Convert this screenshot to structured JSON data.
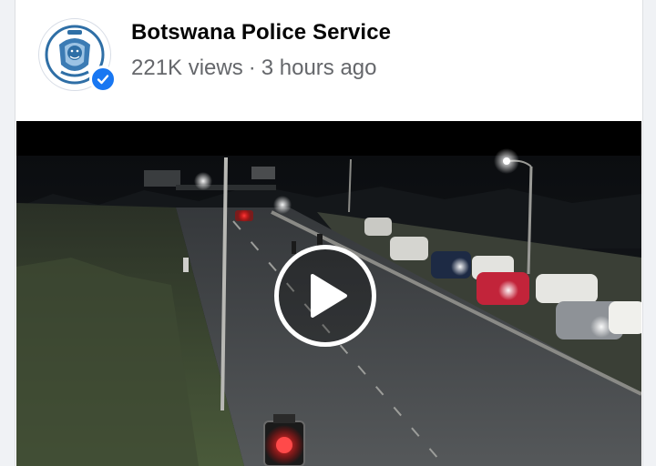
{
  "post": {
    "page_name": "Botswana Police Service",
    "views": "221K views",
    "separator": "·",
    "time_ago": "3 hours ago"
  },
  "video": {
    "state": "paused"
  },
  "icons": {
    "avatar": "police-crest-icon",
    "verified": "verified-check-icon",
    "play": "play-icon"
  },
  "colors": {
    "verified_blue": "#1877f2",
    "name_text": "#050505",
    "meta_text": "#65676b"
  }
}
